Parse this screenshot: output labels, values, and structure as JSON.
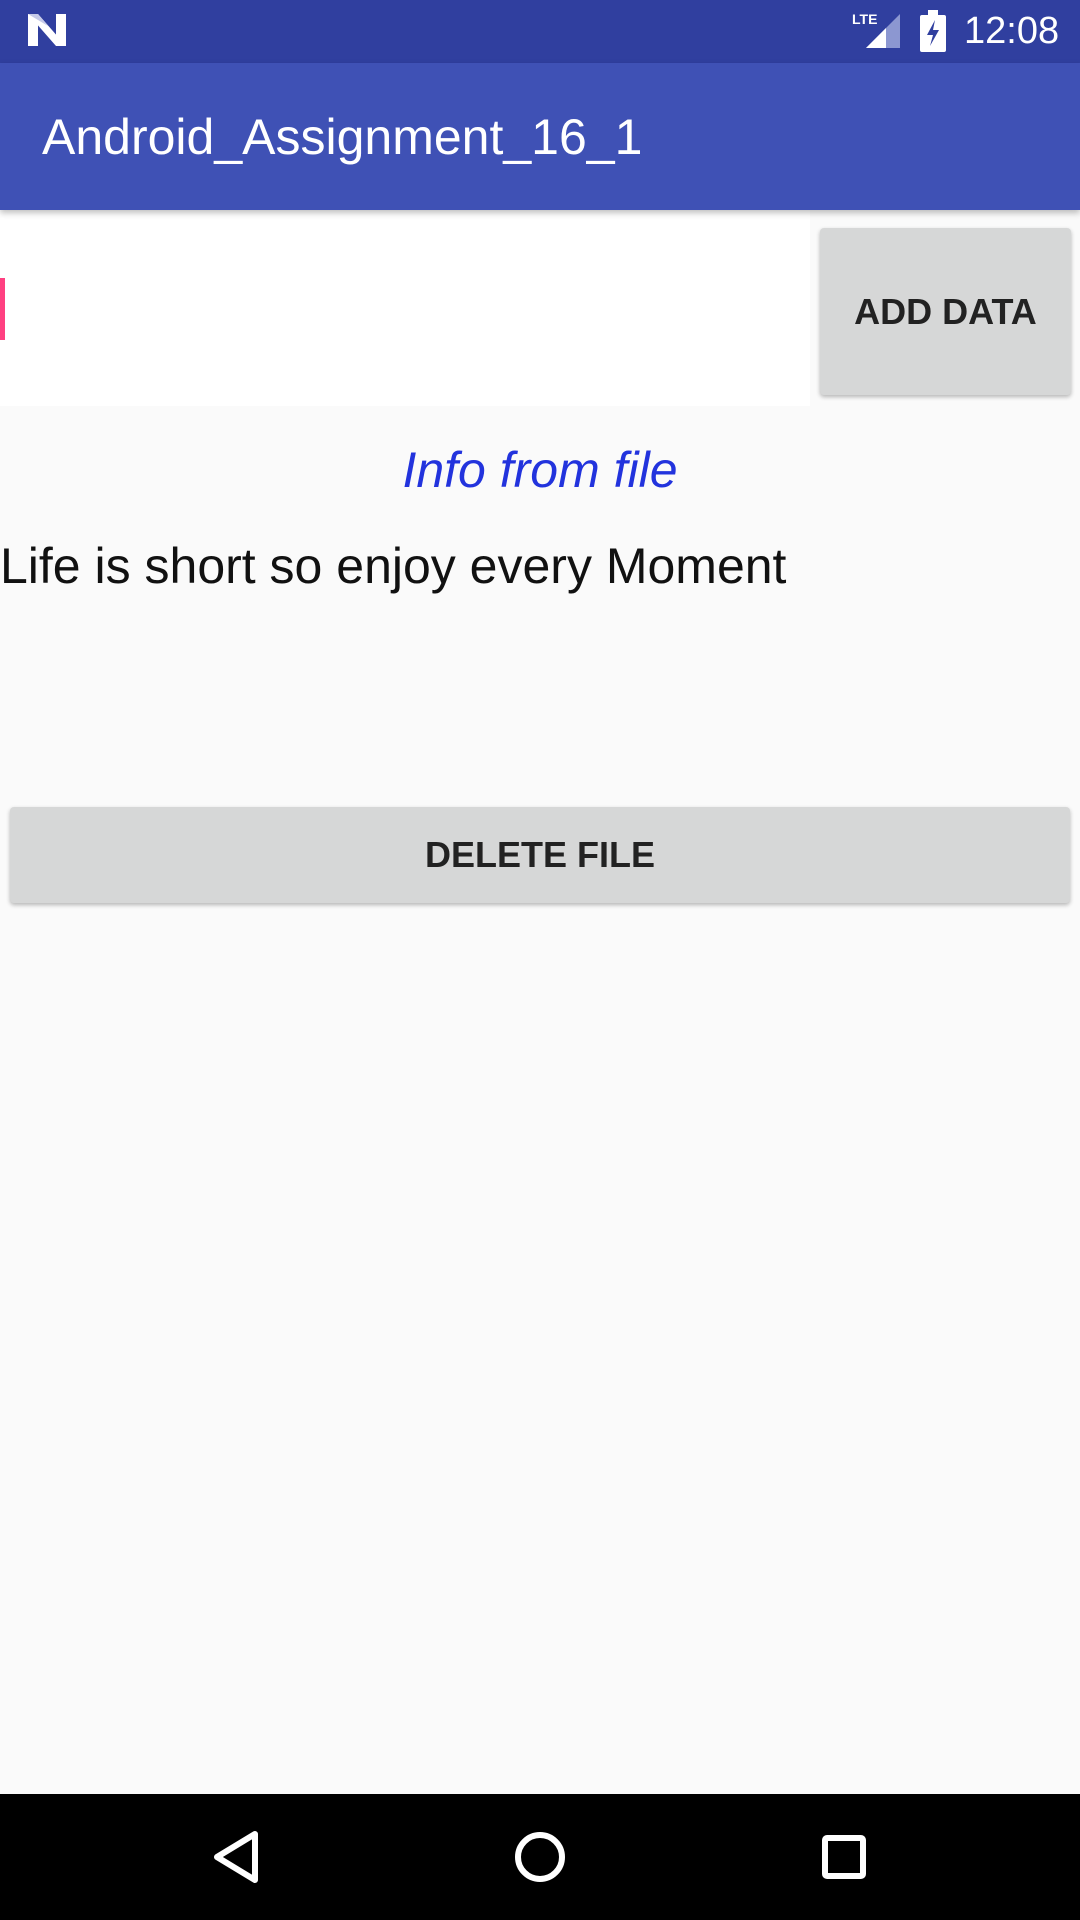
{
  "status_bar": {
    "time": "12:08",
    "network": "LTE",
    "icons": [
      "android-n-logo-icon",
      "lte-signal-icon",
      "battery-charging-icon"
    ]
  },
  "app_bar": {
    "title": "Android_Assignment_16_1"
  },
  "input": {
    "value": "",
    "placeholder": ""
  },
  "buttons": {
    "add_data": "ADD DATA",
    "delete_file": "DELETE FILE"
  },
  "content": {
    "heading": "Info from file",
    "file_text": "Life is short so enjoy every Moment"
  },
  "navigation": {
    "icons": [
      "back-icon",
      "home-icon",
      "recents-icon"
    ]
  },
  "colors": {
    "status_bar": "#303f9f",
    "app_bar": "#3f51b5",
    "accent": "#ff4081",
    "heading": "#2233dd",
    "button": "#d6d7d7"
  }
}
